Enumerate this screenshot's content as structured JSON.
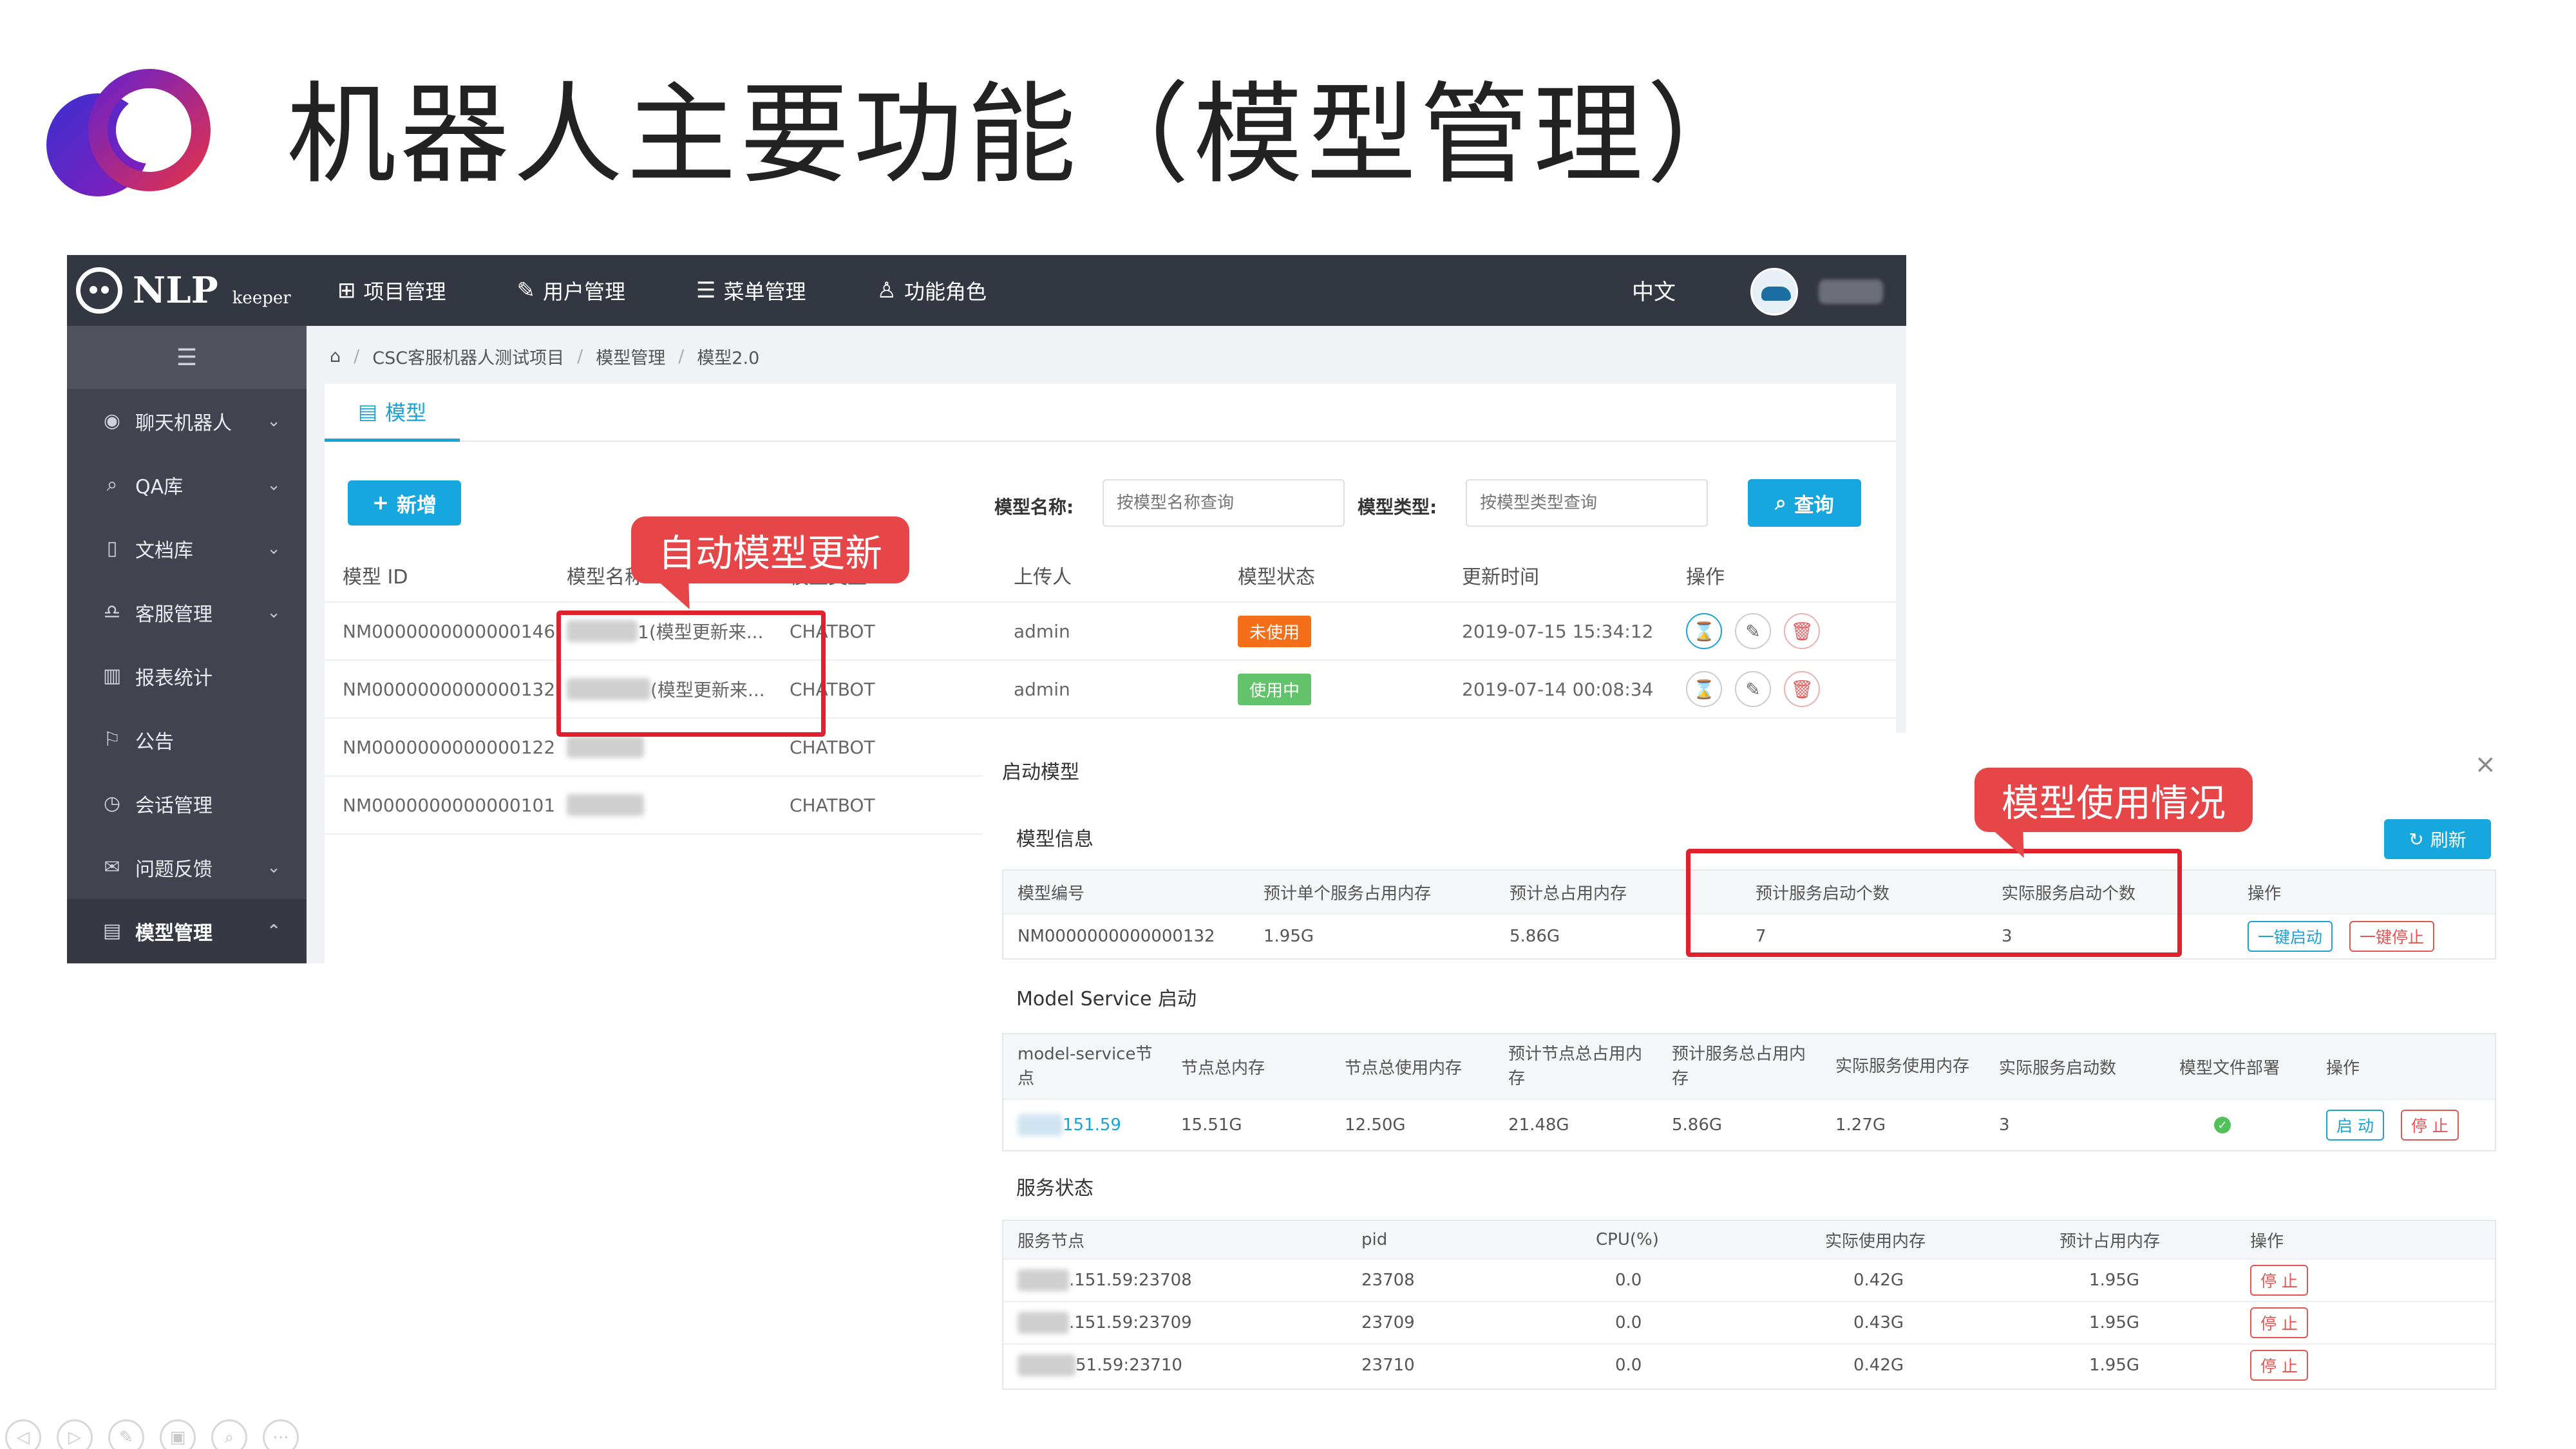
{
  "slide": {
    "title": "机器人主要功能（模型管理）",
    "logo_colors": [
      "#3a2fd1",
      "#8a1cb8",
      "#e0304e"
    ]
  },
  "app": {
    "brand": {
      "name": "NLP",
      "sub": "keeper"
    },
    "nav": [
      {
        "icon": "grid-icon",
        "label": "项目管理"
      },
      {
        "icon": "user-edit-icon",
        "label": "用户管理"
      },
      {
        "icon": "menu-list-icon",
        "label": "菜单管理"
      },
      {
        "icon": "role-icon",
        "label": "功能角色"
      }
    ],
    "language": "中文",
    "sidebar": {
      "items": [
        {
          "icon": "robot-icon",
          "label": "聊天机器人",
          "chevron": "⌄"
        },
        {
          "icon": "search-icon",
          "label": "QA库",
          "chevron": "⌄"
        },
        {
          "icon": "document-icon",
          "label": "文档库",
          "chevron": "⌄"
        },
        {
          "icon": "headset-icon",
          "label": "客服管理",
          "chevron": "⌄"
        },
        {
          "icon": "bar-chart-icon",
          "label": "报表统计",
          "chevron": ""
        },
        {
          "icon": "announce-icon",
          "label": "公告",
          "chevron": ""
        },
        {
          "icon": "clock-icon",
          "label": "会话管理",
          "chevron": ""
        },
        {
          "icon": "mail-icon",
          "label": "问题反馈",
          "chevron": "⌄"
        },
        {
          "icon": "model-icon",
          "label": "模型管理",
          "chevron": "⌃",
          "active": true
        }
      ]
    },
    "breadcrumb": [
      "CSC客服机器人测试项目",
      "模型管理",
      "模型2.0"
    ],
    "tab": "模型",
    "toolbar": {
      "add_label": "新增",
      "name_label": "模型名称:",
      "name_placeholder": "按模型名称查询",
      "type_label": "模型类型:",
      "type_placeholder": "按模型类型查询",
      "query_label": "查询"
    },
    "table": {
      "headers": [
        "模型 ID",
        "模型名称",
        "模型类型",
        "上传人",
        "模型状态",
        "更新时间",
        "操作"
      ],
      "rows": [
        {
          "id": "NM0000000000000146",
          "name": "1(模型更新来...",
          "type": "CHATBOT",
          "uploader": "admin",
          "status": "未使用",
          "status_kind": "off",
          "updated": "2019-07-15 15:34:12"
        },
        {
          "id": "NM0000000000000132",
          "name": "(模型更新来...",
          "type": "CHATBOT",
          "uploader": "admin",
          "status": "使用中",
          "status_kind": "on",
          "updated": "2019-07-14 00:08:34"
        },
        {
          "id": "NM0000000000000122",
          "name": "",
          "type": "CHATBOT",
          "uploader": "",
          "status": "",
          "status_kind": "",
          "updated": ""
        },
        {
          "id": "NM0000000000000101",
          "name": "",
          "type": "CHATBOT",
          "uploader": "",
          "status": "",
          "status_kind": "",
          "updated": ""
        }
      ]
    }
  },
  "dialog": {
    "title": "启动模型",
    "close": "×",
    "model_info": {
      "title": "模型信息",
      "refresh_label": "刷新",
      "headers": [
        "模型编号",
        "预计单个服务占用内存",
        "预计总占用内存",
        "预计服务启动个数",
        "实际服务启动个数",
        "操作"
      ],
      "row": {
        "id": "NM0000000000000132",
        "single_mem": "1.95G",
        "total_mem": "5.86G",
        "expected_count": "7",
        "actual_count": "3",
        "start_label": "一键启动",
        "stop_label": "一键停止"
      }
    },
    "model_service": {
      "title": "Model Service 启动",
      "headers": [
        "model-service节点",
        "节点总内存",
        "节点总使用内存",
        "预计节点总占用内存",
        "预计服务总占用内存",
        "实际服务使用内存",
        "实际服务启动数",
        "模型文件部署",
        "操作"
      ],
      "row": {
        "node": "151.59",
        "total_mem": "15.51G",
        "used_mem": "12.50G",
        "expected_node_mem": "21.48G",
        "expected_service_mem": "5.86G",
        "actual_mem": "1.27G",
        "actual_count": "3",
        "start_label": "启 动",
        "stop_label": "停 止"
      }
    },
    "service_status": {
      "title": "服务状态",
      "headers": [
        "服务节点",
        "pid",
        "CPU(%)",
        "实际使用内存",
        "预计占用内存",
        "操作"
      ],
      "rows": [
        {
          "node": ".151.59:23708",
          "pid": "23708",
          "cpu": "0.0",
          "actual_mem": "0.42G",
          "expected_mem": "1.95G",
          "stop_label": "停 止"
        },
        {
          "node": ".151.59:23709",
          "pid": "23709",
          "cpu": "0.0",
          "actual_mem": "0.43G",
          "expected_mem": "1.95G",
          "stop_label": "停 止"
        },
        {
          "node": "51.59:23710",
          "pid": "23710",
          "cpu": "0.0",
          "actual_mem": "0.42G",
          "expected_mem": "1.95G",
          "stop_label": "停 止"
        }
      ]
    }
  },
  "annotations": {
    "update_label": "自动模型更新",
    "usage_label": "模型使用情况",
    "color": "#e0202c"
  },
  "ppt_toolbar": [
    "prev-icon",
    "next-icon",
    "pen-icon",
    "slides-icon",
    "zoom-icon",
    "more-icon"
  ]
}
